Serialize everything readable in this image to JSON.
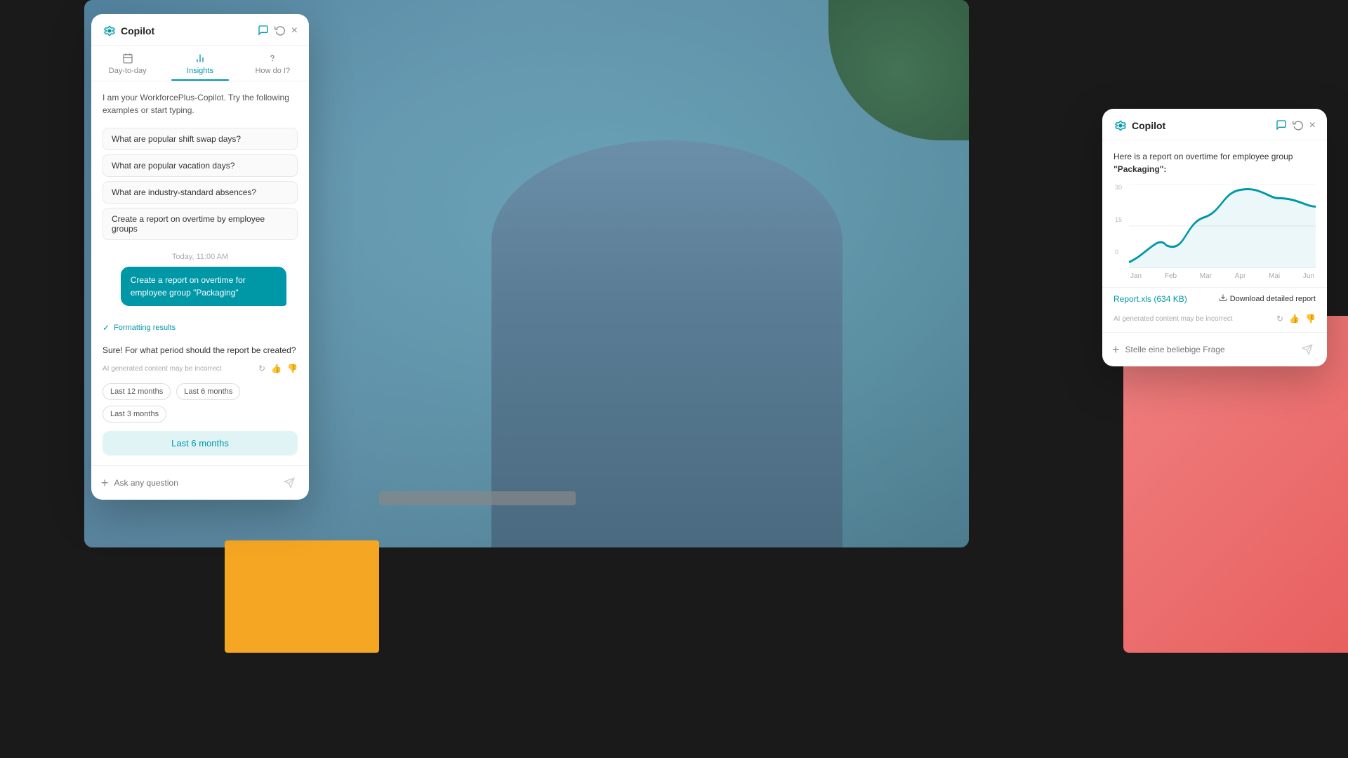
{
  "app": {
    "title": "WorkforcePlus Copilot"
  },
  "left_panel": {
    "title": "Copilot",
    "tabs": [
      {
        "id": "day-to-day",
        "label": "Day-to-day",
        "icon": "📋"
      },
      {
        "id": "insights",
        "label": "Insights",
        "icon": "📊",
        "active": true
      },
      {
        "id": "how-do-i",
        "label": "How do I?",
        "icon": "❓"
      }
    ],
    "intro": "I am your WorkforcePlus-Copilot. Try the following examples or start typing.",
    "suggestions": [
      "What are popular shift swap days?",
      "What are popular vacation days?",
      "What are industry-standard absences?",
      "Create a report on overtime by employee groups"
    ],
    "chat_divider": "Today, 11:00 AM",
    "user_message": "Create a report on overtime for employee group \"Packaging\"",
    "formatting_notice": "Formatting results",
    "ai_response": "Sure! For what period should the report be created?",
    "ai_disclaimer": "AI generated content may be incorrect",
    "period_options": [
      "Last 12 months",
      "Last 6 months",
      "Last 3 months"
    ],
    "selected_period": "Last 6 months",
    "input_placeholder": "Ask any question"
  },
  "right_panel": {
    "title": "Copilot",
    "report_intro": "Here is a report on overtime for employee group",
    "report_group": "\"Packaging\":",
    "chart": {
      "y_labels": [
        "0",
        "15",
        "30"
      ],
      "x_labels": [
        "Jan",
        "Feb",
        "Mar",
        "Apr",
        "Mai",
        "Jun"
      ],
      "values": [
        2,
        8,
        18,
        28,
        25,
        20,
        22
      ]
    },
    "report_link": "Report.xls (634 KB)",
    "download_label": "Download detailed report",
    "ai_disclaimer": "AI generated content may be incorrect",
    "input_placeholder": "Stelle eine beliebige Frage"
  }
}
